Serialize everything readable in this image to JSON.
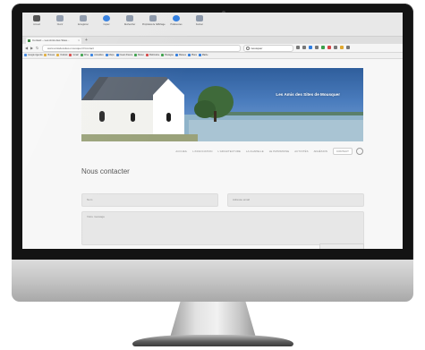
{
  "browser": {
    "menu_items": [
      {
        "label": "Accueil",
        "glyph": "dark"
      },
      {
        "label": "Ouvrir",
        "glyph": "gray"
      },
      {
        "label": "Enregistrer",
        "glyph": "gray"
      },
      {
        "label": "Copier",
        "glyph": "blue"
      },
      {
        "label": "Rechercher",
        "glyph": "gray"
      },
      {
        "label": "Propriétés de l'affichage",
        "glyph": "gray"
      },
      {
        "label": "Préférences",
        "glyph": "blue"
      },
      {
        "label": "Fermer",
        "glyph": "gray"
      }
    ],
    "tab_title": "Contact – Les Amis des Sites...",
    "tab_close": "×",
    "new_tab": "+",
    "back": "◀",
    "forward": "▶",
    "reload": "↻",
    "url": "www.amisdessites-mousquer.fr/contact",
    "search_value": "mousquer",
    "bookmarks": [
      {
        "label": "Google Agenda",
        "color": "#2f7de0"
      },
      {
        "label": "Bureau",
        "color": "#e0a82f"
      },
      {
        "label": "Outlook",
        "color": "#e0a82f"
      },
      {
        "label": "Gmail",
        "color": "#d64545"
      },
      {
        "label": "Drive",
        "color": "#3aa04a"
      },
      {
        "label": "Actualités",
        "color": "#2f7de0"
      },
      {
        "label": "Maps",
        "color": "#2f7de0"
      },
      {
        "label": "Ouest-France",
        "color": "#2f7de0"
      },
      {
        "label": "Météo",
        "color": "#3aa04a"
      },
      {
        "label": "Patrimoine",
        "color": "#d64545"
      },
      {
        "label": "Bretagne",
        "color": "#3aa04a"
      },
      {
        "label": "Marées",
        "color": "#2f7de0"
      },
      {
        "label": "Plans",
        "color": "#2f7de0"
      },
      {
        "label": "Mairie",
        "color": "#2f7de0"
      }
    ]
  },
  "site": {
    "title": "Les Amis des Sites de Mousquer",
    "nav": [
      "ACCUEIL",
      "L'ASSOCIATION",
      "L'ARCHITECTURE",
      "LA CHAPELLE",
      "LE PATRIMOINE",
      "ACTIVITÉS",
      "ADHÉSION",
      "CONTACT"
    ],
    "active_nav": "CONTACT"
  },
  "contact": {
    "title": "Nous contacter",
    "name_placeholder": "Nom",
    "email_placeholder": "Adresse email",
    "message_placeholder": "Votre message"
  }
}
